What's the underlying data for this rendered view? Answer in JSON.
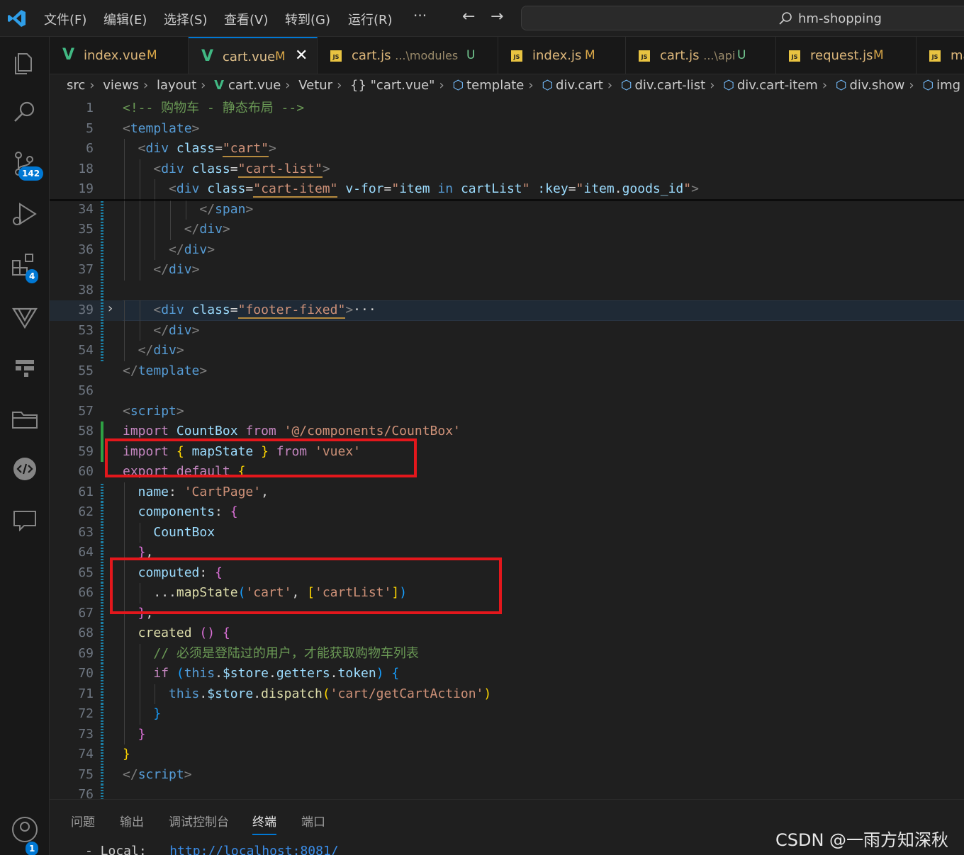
{
  "menu": [
    "文件(F)",
    "编辑(E)",
    "选择(S)",
    "查看(V)",
    "转到(G)",
    "运行(R)"
  ],
  "menu_more": "···",
  "nav": {
    "back": "←",
    "forward": "→"
  },
  "search": {
    "label": "hm-shopping"
  },
  "activity": {
    "scm_badge": "142",
    "extensions_badge": "4",
    "account_badge": "1"
  },
  "tabs": [
    {
      "name": "index.vue",
      "path": "",
      "status": "M",
      "icon": "vue-icon"
    },
    {
      "name": "cart.vue",
      "path": "",
      "status": "M",
      "icon": "vue-icon",
      "close": "✕"
    },
    {
      "name": "cart.js",
      "path": "...\\modules",
      "status": "U",
      "icon": "js-icon"
    },
    {
      "name": "index.js",
      "path": "",
      "status": "M",
      "icon": "js-icon"
    },
    {
      "name": "cart.js",
      "path": "...\\api",
      "status": "U",
      "icon": "js-icon"
    },
    {
      "name": "request.js",
      "path": "",
      "status": "M",
      "icon": "js-icon"
    },
    {
      "name": "ma",
      "path": "",
      "status": "",
      "icon": "js-icon"
    }
  ],
  "breadcrumb": [
    "src",
    "views",
    "layout",
    "cart.vue",
    "Vetur",
    "{} \"cart.vue\"",
    "template",
    "div.cart",
    "div.cart-list",
    "div.cart-item",
    "div.show",
    "img"
  ],
  "editor": {
    "lines": [
      {
        "n": "1",
        "segs": [
          [
            "c-com",
            "<!-- 购物车 - 静态布局 -->"
          ]
        ],
        "indent": 4
      },
      {
        "n": "5",
        "segs": [
          [
            "c-br",
            "<"
          ],
          [
            "c-tag",
            "template"
          ],
          [
            "c-br",
            ">"
          ]
        ],
        "indent": 4
      },
      {
        "n": "6",
        "segs": [
          [
            "c-br",
            "<"
          ],
          [
            "c-tag",
            "div"
          ],
          [
            "c-def",
            " "
          ],
          [
            "c-attr",
            "class"
          ],
          [
            "c-def",
            "="
          ],
          [
            "c-str",
            "\"cart\""
          ],
          [
            "c-br",
            ">"
          ]
        ],
        "indent": 6
      },
      {
        "n": "18",
        "segs": [
          [
            "c-br",
            "<"
          ],
          [
            "c-tag",
            "div"
          ],
          [
            "c-def",
            " "
          ],
          [
            "c-attr",
            "class"
          ],
          [
            "c-def",
            "="
          ],
          [
            "c-str",
            "\"cart-list\""
          ],
          [
            "c-br",
            ">"
          ]
        ],
        "indent": 8
      },
      {
        "n": "19",
        "segs": [
          [
            "c-br",
            "<"
          ],
          [
            "c-tag",
            "div"
          ],
          [
            "c-def",
            " "
          ],
          [
            "c-attr",
            "class"
          ],
          [
            "c-def",
            "="
          ],
          [
            "c-str",
            "\"cart-item\""
          ],
          [
            "c-def",
            " "
          ],
          [
            "c-attr",
            "v-for"
          ],
          [
            "c-def",
            "="
          ],
          [
            "c-str",
            "\""
          ],
          [
            "c-var",
            "item"
          ],
          [
            "c-def",
            " "
          ],
          [
            "c-blu",
            "in"
          ],
          [
            "c-def",
            " "
          ],
          [
            "c-var",
            "cartList"
          ],
          [
            "c-str",
            "\""
          ],
          [
            "c-def",
            " "
          ],
          [
            "c-attr",
            ":key"
          ],
          [
            "c-def",
            "="
          ],
          [
            "c-str",
            "\""
          ],
          [
            "c-var",
            "item"
          ],
          [
            "c-def",
            "."
          ],
          [
            "c-var",
            "goods_id"
          ],
          [
            "c-str",
            "\""
          ],
          [
            "c-br",
            ">"
          ]
        ],
        "indent": 10
      },
      {
        "n": "34",
        "segs": [
          [
            "c-br",
            "</"
          ],
          [
            "c-tag",
            "span"
          ],
          [
            "c-br",
            ">"
          ]
        ],
        "indent": 14
      },
      {
        "n": "35",
        "segs": [
          [
            "c-br",
            "</"
          ],
          [
            "c-tag",
            "div"
          ],
          [
            "c-br",
            ">"
          ]
        ],
        "indent": 12
      },
      {
        "n": "36",
        "segs": [
          [
            "c-br",
            "</"
          ],
          [
            "c-tag",
            "div"
          ],
          [
            "c-br",
            ">"
          ]
        ],
        "indent": 10
      },
      {
        "n": "37",
        "segs": [
          [
            "c-br",
            "</"
          ],
          [
            "c-tag",
            "div"
          ],
          [
            "c-br",
            ">"
          ]
        ],
        "indent": 8
      },
      {
        "n": "38",
        "segs": [],
        "indent": 0
      },
      {
        "n": "39",
        "segs": [
          [
            "c-br",
            "<"
          ],
          [
            "c-tag",
            "div"
          ],
          [
            "c-def",
            " "
          ],
          [
            "c-attr",
            "class"
          ],
          [
            "c-def",
            "="
          ],
          [
            "c-str",
            "\"footer-fixed\""
          ],
          [
            "c-br",
            ">"
          ],
          [
            "c-def",
            "···"
          ]
        ],
        "indent": 8
      },
      {
        "n": "53",
        "segs": [
          [
            "c-br",
            "</"
          ],
          [
            "c-tag",
            "div"
          ],
          [
            "c-br",
            ">"
          ]
        ],
        "indent": 8
      },
      {
        "n": "54",
        "segs": [
          [
            "c-br",
            "</"
          ],
          [
            "c-tag",
            "div"
          ],
          [
            "c-br",
            ">"
          ]
        ],
        "indent": 6
      },
      {
        "n": "55",
        "segs": [
          [
            "c-br",
            "</"
          ],
          [
            "c-tag",
            "template"
          ],
          [
            "c-br",
            ">"
          ]
        ],
        "indent": 4
      },
      {
        "n": "56",
        "segs": [],
        "indent": 0
      },
      {
        "n": "57",
        "segs": [
          [
            "c-br",
            "<"
          ],
          [
            "c-tag",
            "script"
          ],
          [
            "c-br",
            ">"
          ]
        ],
        "indent": 4
      },
      {
        "n": "58",
        "segs": [
          [
            "c-kw",
            "import"
          ],
          [
            "c-def",
            " "
          ],
          [
            "c-var",
            "CountBox"
          ],
          [
            "c-def",
            " "
          ],
          [
            "c-kw",
            "from"
          ],
          [
            "c-def",
            " "
          ],
          [
            "c-str",
            "'@/components/CountBox'"
          ]
        ],
        "indent": 4
      },
      {
        "n": "59",
        "segs": [
          [
            "c-kw",
            "import"
          ],
          [
            "c-def",
            " "
          ],
          [
            "c-yb",
            "{"
          ],
          [
            "c-def",
            " "
          ],
          [
            "c-var",
            "mapState"
          ],
          [
            "c-def",
            " "
          ],
          [
            "c-yb",
            "}"
          ],
          [
            "c-def",
            " "
          ],
          [
            "c-kw",
            "from"
          ],
          [
            "c-def",
            " "
          ],
          [
            "c-str",
            "'vuex'"
          ]
        ],
        "indent": 4
      },
      {
        "n": "60",
        "segs": [
          [
            "c-kw",
            "export"
          ],
          [
            "c-def",
            " "
          ],
          [
            "c-kw",
            "default"
          ],
          [
            "c-def",
            " "
          ],
          [
            "c-yb",
            "{"
          ]
        ],
        "indent": 4
      },
      {
        "n": "61",
        "segs": [
          [
            "c-var",
            "name"
          ],
          [
            "c-def",
            ": "
          ],
          [
            "c-str",
            "'CartPage'"
          ],
          [
            "c-def",
            ","
          ]
        ],
        "indent": 6
      },
      {
        "n": "62",
        "segs": [
          [
            "c-var",
            "components"
          ],
          [
            "c-def",
            ": "
          ],
          [
            "c-pb",
            "{"
          ]
        ],
        "indent": 6
      },
      {
        "n": "63",
        "segs": [
          [
            "c-var",
            "CountBox"
          ]
        ],
        "indent": 8
      },
      {
        "n": "64",
        "segs": [
          [
            "c-pb",
            "}"
          ],
          [
            "c-def",
            ","
          ]
        ],
        "indent": 6
      },
      {
        "n": "65",
        "segs": [
          [
            "c-var",
            "computed"
          ],
          [
            "c-def",
            ": "
          ],
          [
            "c-pb",
            "{"
          ]
        ],
        "indent": 6
      },
      {
        "n": "66",
        "segs": [
          [
            "c-def",
            "..."
          ],
          [
            "c-fn",
            "mapState"
          ],
          [
            "c-bb",
            "("
          ],
          [
            "c-str",
            "'cart'"
          ],
          [
            "c-def",
            ", "
          ],
          [
            "c-yb",
            "["
          ],
          [
            "c-str",
            "'cartList'"
          ],
          [
            "c-yb",
            "]"
          ],
          [
            "c-bb",
            ")"
          ]
        ],
        "indent": 8
      },
      {
        "n": "67",
        "segs": [
          [
            "c-pb",
            "}"
          ],
          [
            "c-def",
            ","
          ]
        ],
        "indent": 6
      },
      {
        "n": "68",
        "segs": [
          [
            "c-fn",
            "created"
          ],
          [
            "c-def",
            " "
          ],
          [
            "c-pb",
            "()"
          ],
          [
            "c-def",
            " "
          ],
          [
            "c-pb",
            "{"
          ]
        ],
        "indent": 6
      },
      {
        "n": "69",
        "segs": [
          [
            "c-com",
            "// 必须是登陆过的用户，才能获取购物车列表"
          ]
        ],
        "indent": 8
      },
      {
        "n": "70",
        "segs": [
          [
            "c-kw",
            "if"
          ],
          [
            "c-def",
            " "
          ],
          [
            "c-bb",
            "("
          ],
          [
            "c-blu",
            "this"
          ],
          [
            "c-def",
            "."
          ],
          [
            "c-var",
            "$store"
          ],
          [
            "c-def",
            "."
          ],
          [
            "c-var",
            "getters"
          ],
          [
            "c-def",
            "."
          ],
          [
            "c-var",
            "token"
          ],
          [
            "c-bb",
            ")"
          ],
          [
            "c-def",
            " "
          ],
          [
            "c-bb",
            "{"
          ]
        ],
        "indent": 8
      },
      {
        "n": "71",
        "segs": [
          [
            "c-blu",
            "this"
          ],
          [
            "c-def",
            "."
          ],
          [
            "c-var",
            "$store"
          ],
          [
            "c-def",
            "."
          ],
          [
            "c-fn",
            "dispatch"
          ],
          [
            "c-yb",
            "("
          ],
          [
            "c-str",
            "'cart/getCartAction'"
          ],
          [
            "c-yb",
            ")"
          ]
        ],
        "indent": 10
      },
      {
        "n": "72",
        "segs": [
          [
            "c-bb",
            "}"
          ]
        ],
        "indent": 8
      },
      {
        "n": "73",
        "segs": [
          [
            "c-pb",
            "}"
          ]
        ],
        "indent": 6
      },
      {
        "n": "74",
        "segs": [
          [
            "c-yb",
            "}"
          ]
        ],
        "indent": 4
      },
      {
        "n": "75",
        "segs": [
          [
            "c-br",
            "</"
          ],
          [
            "c-tag",
            "script"
          ],
          [
            "c-br",
            ">"
          ]
        ],
        "indent": 4
      },
      {
        "n": "76",
        "segs": [],
        "indent": 0
      }
    ]
  },
  "panel": {
    "tabs": [
      "问题",
      "输出",
      "调试控制台",
      "终端",
      "端口"
    ],
    "active": "终端",
    "terminal_prefix": "- Local:   ",
    "terminal_url": "http://localhost:8081/"
  },
  "watermark": "CSDN @一雨方知深秋",
  "colors": {
    "accent": "#0078d4",
    "highlight_box": "#e3171c",
    "vue": "#41b883",
    "js": "#e8c341"
  }
}
